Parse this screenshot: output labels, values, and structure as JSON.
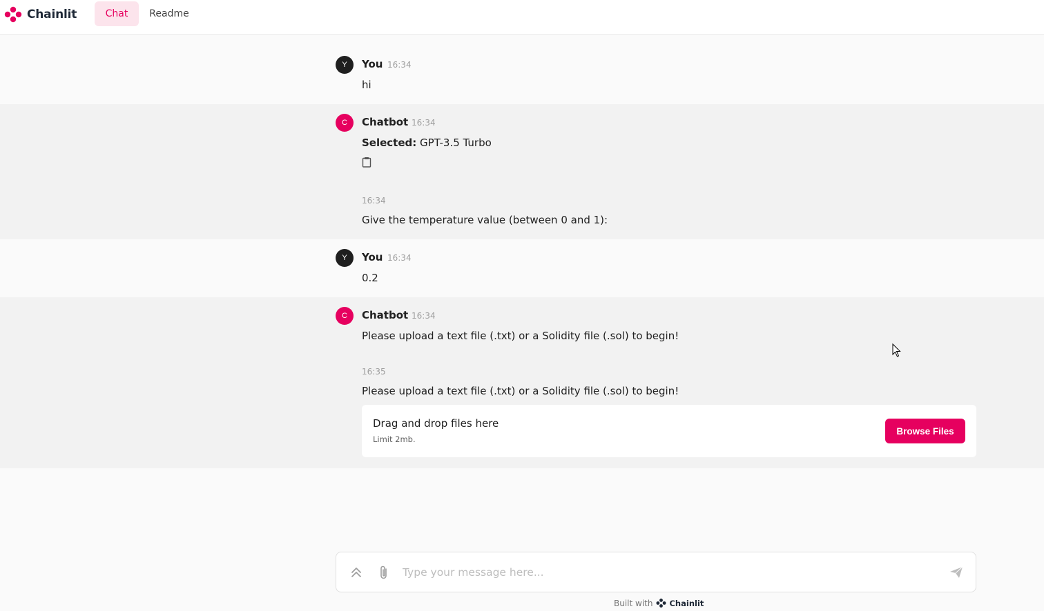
{
  "header": {
    "app_name": "Chainlit",
    "tabs": [
      {
        "label": "Chat",
        "active": true
      },
      {
        "label": "Readme",
        "active": false
      }
    ],
    "accent_color": "#e6005f"
  },
  "messages": [
    {
      "author": "You",
      "avatar": "Y",
      "time": "16:34",
      "text": "hi"
    },
    {
      "author": "Chatbot",
      "avatar": "C",
      "time": "16:34",
      "selected_label": "Selected:",
      "selected_value": "GPT-3.5 Turbo",
      "icon": "clipboard-icon"
    },
    {
      "time": "16:34",
      "text": "Give the temperature value (between 0 and 1):"
    },
    {
      "author": "You",
      "avatar": "Y",
      "time": "16:34",
      "text": "0.2"
    },
    {
      "author": "Chatbot",
      "avatar": "C",
      "time": "16:34",
      "text": "Please upload a text file (.txt) or a Solidity file (.sol) to begin!"
    },
    {
      "time": "16:35",
      "text": "Please upload a text file (.txt) or a Solidity file (.sol) to begin!"
    }
  ],
  "upload": {
    "title": "Drag and drop files here",
    "limit": "Limit 2mb.",
    "button": "Browse Files"
  },
  "composer": {
    "placeholder": "Type your message here..."
  },
  "footer": {
    "prefix": "Built with",
    "brand": "Chainlit"
  }
}
